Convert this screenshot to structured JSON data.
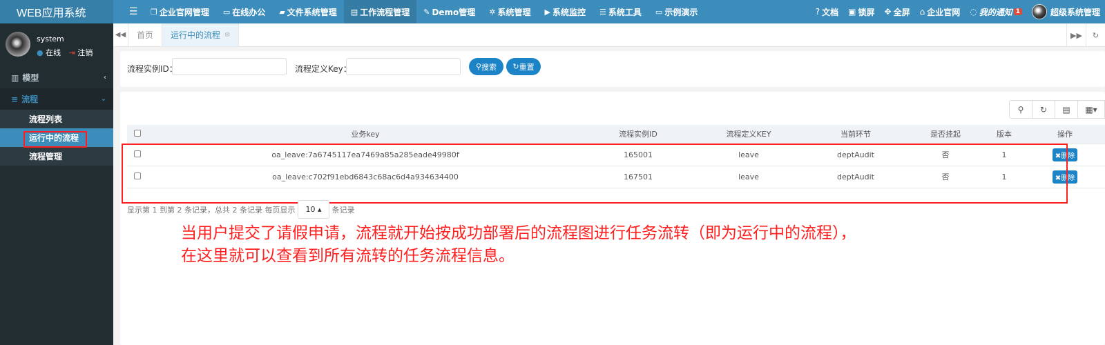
{
  "app": {
    "title": "WEB应用系统"
  },
  "topmenu": [
    {
      "label": "企业官网管理",
      "icon": "copy-icon",
      "glyph": "❐"
    },
    {
      "label": "在线办公",
      "icon": "keyboard-icon",
      "glyph": "▭"
    },
    {
      "label": "文件系统管理",
      "icon": "folder-icon",
      "glyph": "▰"
    },
    {
      "label": "工作流程管理",
      "icon": "list-alt-icon",
      "glyph": "▤",
      "active": true
    },
    {
      "label": "Demo管理",
      "icon": "edit-icon",
      "glyph": "✎"
    },
    {
      "label": "系统管理",
      "icon": "gear-icon",
      "glyph": "✲"
    },
    {
      "label": "系统监控",
      "icon": "video-icon",
      "glyph": "▶"
    },
    {
      "label": "系统工具",
      "icon": "bars-icon",
      "glyph": "☰"
    },
    {
      "label": "示例演示",
      "icon": "desktop-icon",
      "glyph": "▭"
    }
  ],
  "rightmenu": {
    "docs": "文档",
    "lock": "锁屏",
    "fullscreen": "全屏",
    "site": "企业官网",
    "notify": "我的通知",
    "notify_count": "1",
    "user": "超级系统管理"
  },
  "user": {
    "name": "system",
    "status": "在线",
    "logout": "注销"
  },
  "sidebar": {
    "items": [
      {
        "label": "模型"
      },
      {
        "label": "流程"
      }
    ],
    "sub": [
      "流程列表",
      "运行中的流程",
      "流程管理"
    ]
  },
  "tabs": {
    "home": "首页",
    "current": "运行中的流程"
  },
  "search": {
    "instance_label": "流程实例ID：",
    "key_label": "流程定义Key：",
    "search_btn": "搜索",
    "reset_btn": "重置"
  },
  "table": {
    "headers": [
      "业务key",
      "流程实例ID",
      "流程定义KEY",
      "当前环节",
      "是否挂起",
      "版本",
      "操作"
    ],
    "rows": [
      {
        "bizkey": "oa_leave:7a6745117ea7469a85a285eade49980f",
        "instance": "165001",
        "defkey": "leave",
        "node": "deptAudit",
        "suspended": "否",
        "version": "1",
        "action": "删除"
      },
      {
        "bizkey": "oa_leave:c702f91ebd6843c68ac6d4a934634400",
        "instance": "167501",
        "defkey": "leave",
        "node": "deptAudit",
        "suspended": "否",
        "version": "1",
        "action": "删除"
      }
    ]
  },
  "pagination": {
    "info": "显示第 1 到第 2 条记录，总共 2 条记录",
    "per_page_label": "每页显示",
    "page_size": "10",
    "suffix": "条记录"
  },
  "annotation": {
    "line1": "当用户提交了请假申请，流程就开始按成功部署后的流程图进行任务流转（即为运行中的流程），",
    "line2": "在这里就可以查看到所有流转的任务流程信息。"
  },
  "colors": {
    "header": "#3c8dbc",
    "sidebar": "#222d32",
    "primary": "#1c84c6",
    "highlight": "#ff1e1e"
  }
}
